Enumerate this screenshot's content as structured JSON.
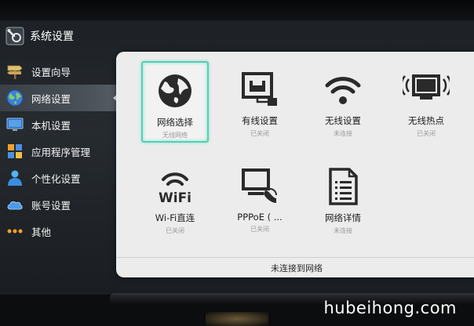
{
  "header": {
    "title": "系统设置",
    "icon": "wrench-gear-icon"
  },
  "sidebar": {
    "items": [
      {
        "label": "设置向导",
        "icon": "signpost-icon",
        "selected": false
      },
      {
        "label": "网络设置",
        "icon": "globe-icon",
        "selected": true
      },
      {
        "label": "本机设置",
        "icon": "monitor-icon",
        "selected": false
      },
      {
        "label": "应用程序管理",
        "icon": "app-grid-icon",
        "selected": false
      },
      {
        "label": "个性化设置",
        "icon": "person-icon",
        "selected": false
      },
      {
        "label": "账号设置",
        "icon": "cloud-account-icon",
        "selected": false
      },
      {
        "label": "其他",
        "icon": "more-dots-icon",
        "selected": false
      }
    ]
  },
  "main": {
    "tiles": [
      {
        "label": "网络选择",
        "status": "无线网络",
        "icon": "globe-icon",
        "selected": true
      },
      {
        "label": "有线设置",
        "status": "已关闭",
        "icon": "ethernet-port-icon",
        "selected": false
      },
      {
        "label": "无线设置",
        "status": "未连接",
        "icon": "wifi-signal-icon",
        "selected": false
      },
      {
        "label": "无线热点",
        "status": "已关闭",
        "icon": "hotspot-monitor-icon",
        "selected": false
      },
      {
        "label": "Wi-Fi直连",
        "status": "已关闭",
        "icon": "wifi-text-icon",
        "icon_text": "WiFi",
        "selected": false
      },
      {
        "label": "PPPoE ( ...",
        "status": "已关闭",
        "icon": "pppoe-phone-icon",
        "selected": false
      },
      {
        "label": "网络详情",
        "status": "未连接",
        "icon": "document-list-icon",
        "selected": false
      }
    ],
    "status_bar": "未连接到网络"
  },
  "watermark": "hubeihong.com",
  "colors": {
    "selection_border": "#55d0b4",
    "panel_bg": "#ececec",
    "sidebar_bg": "#22262b"
  }
}
